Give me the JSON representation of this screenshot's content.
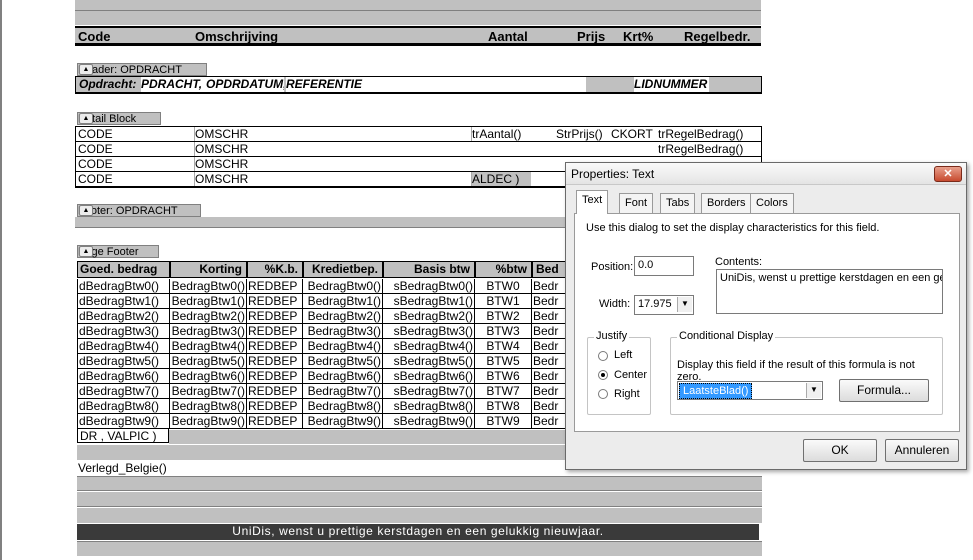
{
  "column_header": {
    "code": "Code",
    "omschrijving": "Omschrijving",
    "aantal": "Aantal",
    "prijs": "Prijs",
    "krt": "Krt%",
    "regelbedr": "Regelbedr."
  },
  "sections": {
    "header": "Header: OPDRACHT",
    "detail": "Detail Block",
    "footer": "Footer: OPDRACHT",
    "page_footer": "Page Footer"
  },
  "header_row": {
    "label": "Opdracht:",
    "f1": "PDRACHT,",
    "f2": "OPDRDATUM,",
    "f3": "REFERENTIE",
    "f4": "LIDNUMMER"
  },
  "detail_rows": [
    {
      "code": "CODE",
      "omschr": "OMSCHR",
      "aantal": "trAantal()",
      "prijs": "StrPrijs()",
      "kort": "CKORT",
      "regel": "trRegelBedrag()"
    },
    {
      "code": "CODE",
      "omschr": "OMSCHR",
      "aantal": "",
      "prijs": "",
      "kort": "",
      "regel": "trRegelBedrag()"
    },
    {
      "code": "CODE",
      "omschr": "OMSCHR",
      "aantal": "",
      "prijs": "",
      "kort": "",
      "regel": ""
    },
    {
      "code": "CODE",
      "omschr": "OMSCHR",
      "aantal": "ALDEC )",
      "prijs": "",
      "kort": "",
      "regel": ""
    }
  ],
  "page_footer_table": {
    "headers": [
      "Goed. bedrag",
      "Korting",
      "%K.b.",
      "Kredietbep.",
      "Basis btw",
      "%btw",
      "Bed"
    ],
    "rows": [
      [
        "dBedragBtw0()",
        "BedragBtw0()",
        "REDBEP",
        "BedragBtw0()",
        "sBedragBtw0()",
        "BTW0",
        "Bedr"
      ],
      [
        "dBedragBtw1()",
        "BedragBtw1()",
        "REDBEP",
        "BedragBtw1()",
        "sBedragBtw1()",
        "BTW1",
        "Bedr"
      ],
      [
        "dBedragBtw2()",
        "BedragBtw2()",
        "REDBEP",
        "BedragBtw2()",
        "sBedragBtw2()",
        "BTW2",
        "Bedr"
      ],
      [
        "dBedragBtw3()",
        "BedragBtw3()",
        "REDBEP",
        "BedragBtw3()",
        "sBedragBtw3()",
        "BTW3",
        "Bedr"
      ],
      [
        "dBedragBtw4()",
        "BedragBtw4()",
        "REDBEP",
        "BedragBtw4()",
        "sBedragBtw4()",
        "BTW4",
        "Bedr"
      ],
      [
        "dBedragBtw5()",
        "BedragBtw5()",
        "REDBEP",
        "BedragBtw5()",
        "sBedragBtw5()",
        "BTW5",
        "Bedr"
      ],
      [
        "dBedragBtw6()",
        "BedragBtw6()",
        "REDBEP",
        "BedragBtw6()",
        "sBedragBtw6()",
        "BTW6",
        "Bedr"
      ],
      [
        "dBedragBtw7()",
        "BedragBtw7()",
        "REDBEP",
        "BedragBtw7()",
        "sBedragBtw7()",
        "BTW7",
        "Bedr"
      ],
      [
        "dBedragBtw8()",
        "BedragBtw8()",
        "REDBEP",
        "BedragBtw8()",
        "sBedragBtw8()",
        "BTW8",
        "Bedr"
      ],
      [
        "dBedragBtw9()",
        "BedragBtw9()",
        "REDBEP",
        "BedragBtw9()",
        "sBedragBtw9()",
        "BTW9",
        "Bedr"
      ]
    ],
    "extra": "DR , VALPIC )"
  },
  "verlegd": "Verlegd_Belgie()",
  "banner": "UniDis, wenst u prettige kerstdagen en een gelukkig nieuwjaar.",
  "dialog": {
    "title": "Properties: Text",
    "close": "✕",
    "tabs": [
      "Text",
      "Font",
      "Tabs",
      "Borders",
      "Colors"
    ],
    "description": "Use this dialog to set the display characteristics for this field.",
    "position_label": "Position:",
    "position_value": "0.0",
    "width_label": "Width:",
    "width_value": "17.975",
    "contents_label": "Contents:",
    "contents_value": "UniDis, wenst u prettige kerstdagen en een geli",
    "justify_label": "Justify",
    "justify_options": [
      "Left",
      "Center",
      "Right"
    ],
    "justify_selected": "Center",
    "conditional_label": "Conditional Display",
    "conditional_text": "Display this field if the result of this formula is not zero.",
    "formula_value": "LaatsteBlad()",
    "formula_button": "Formula...",
    "ok": "OK",
    "cancel": "Annuleren"
  },
  "colors": {
    "band_gray": "#c0c0c0",
    "selection_blue": "#3399ff",
    "banner_bg": "#3a3a3a"
  }
}
